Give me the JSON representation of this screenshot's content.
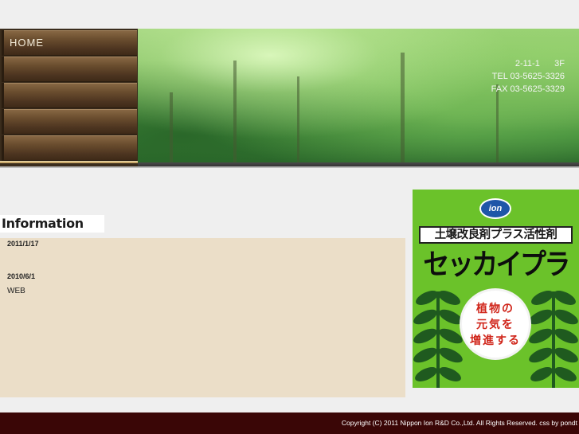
{
  "nav": {
    "items": [
      {
        "label": "HOME"
      },
      {
        "label": ""
      },
      {
        "label": ""
      },
      {
        "label": ""
      },
      {
        "label": ""
      }
    ]
  },
  "header": {
    "address_lines": [
      "2-11-1      3F",
      "TEL 03-5625-3326",
      "FAX 03-5625-3329"
    ]
  },
  "info": {
    "heading": "Information",
    "news": [
      {
        "date": "2011/1/17",
        "text": ""
      },
      {
        "date": "2010/6/1",
        "text": "WEB"
      }
    ]
  },
  "banner": {
    "logo_text": "ion",
    "subtitle": "土壌改良剤プラス活性剤",
    "title": "セッカイプラス",
    "circle_lines": [
      "植物の",
      "元気を",
      "増進する"
    ],
    "colors": {
      "background": "#6bc22a",
      "circle_text": "#d0261b",
      "logo": "#1e56a8"
    }
  },
  "footer": {
    "copyright": "Copyright (C) 2011 Nippon Ion R&D Co.,Ltd. All Rights Reserved. css by pondt"
  }
}
